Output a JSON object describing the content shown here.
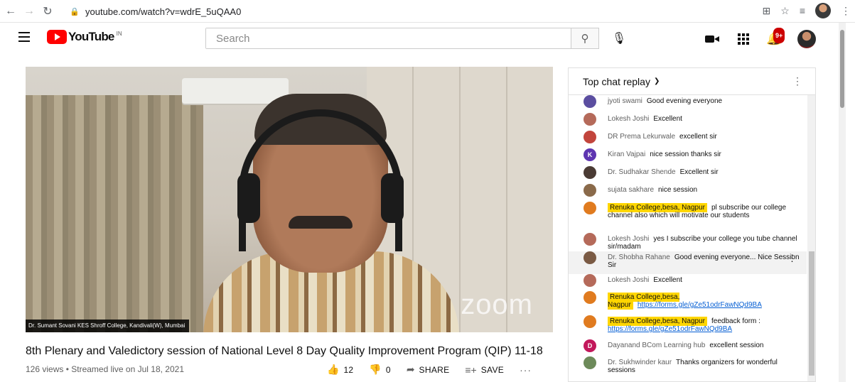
{
  "browser": {
    "url": "youtube.com/watch?v=wdrE_5uQAA0"
  },
  "header": {
    "logo_text": "YouTube",
    "country": "IN",
    "search_placeholder": "Search",
    "notifications_badge": "9+"
  },
  "video": {
    "zoom_watermark": "zoom",
    "caption": "Dr. Sumant Sovani KES Shroff College, Kandivali(W), Mumbai",
    "title": "8th Plenary and Valedictory session of National Level 8 Day Quality Improvement Program (QIP) 11-18",
    "meta": "126 views • Streamed live on Jul 18, 2021",
    "likes": "12",
    "dislikes": "0",
    "share_label": "SHARE",
    "save_label": "SAVE"
  },
  "chat": {
    "header": "Top chat replay",
    "messages": [
      {
        "author": "jyoti swami",
        "text": "Good evening everyone",
        "avatar_color": "#5b4ea0",
        "initial": ""
      },
      {
        "author": "Lokesh Joshi",
        "text": "Excellent",
        "avatar_color": "#b56a5a",
        "initial": ""
      },
      {
        "author": "DR Prema Lekurwale",
        "text": "excellent sir",
        "avatar_color": "#c2453c",
        "initial": ""
      },
      {
        "author": "Kiran Vajpai",
        "text": "nice session thanks sir",
        "avatar_color": "#5e35b1",
        "initial": "K"
      },
      {
        "author": "Dr. Sudhakar Shende",
        "text": "Excellent sir",
        "avatar_color": "#4a3b34",
        "initial": ""
      },
      {
        "author": "sujata sakhare",
        "text": "nice session",
        "avatar_color": "#8a6a4a",
        "initial": ""
      },
      {
        "author": "Renuka College,besa, Nagpur",
        "text": "pl subscribe our college channel also which will motivate our students",
        "avatar_color": "#e07b1f",
        "initial": "",
        "highlight": true
      },
      {
        "author": "Lokesh Joshi",
        "text": "yes I subscribe your college you tube channel sir/madam",
        "avatar_color": "#b56a5a",
        "initial": ""
      },
      {
        "author": "Dr. Shobha Rahane",
        "text": "Good evening everyone... Nice Session Sir",
        "avatar_color": "#7a5a44",
        "initial": ""
      },
      {
        "author": "Lokesh Joshi",
        "text": "Excellent",
        "avatar_color": "#b56a5a",
        "initial": ""
      },
      {
        "author": "Renuka College,besa, Nagpur",
        "text": "https://forms.gle/gZe51odrFawNQd9BA",
        "avatar_color": "#e07b1f",
        "initial": "",
        "highlight": true,
        "link": true
      },
      {
        "author": "Renuka College,besa, Nagpur",
        "text_prefix": "feedback form : ",
        "text": "https://forms.gle/gZe51odrFawNQd9BA",
        "avatar_color": "#e07b1f",
        "initial": "",
        "highlight": true,
        "link": true
      },
      {
        "author": "Dayanand BCom Learning hub",
        "text": "excellent session",
        "avatar_color": "#c2185b",
        "initial": "D"
      },
      {
        "author": "Dr. Sukhwinder kaur",
        "text": "Thanks organizers for wonderful sessions",
        "avatar_color": "#6d8a5a",
        "initial": ""
      }
    ]
  }
}
